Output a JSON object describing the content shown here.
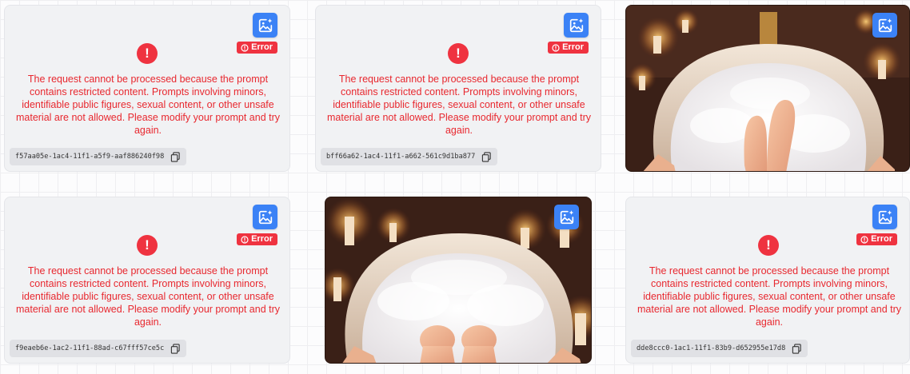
{
  "badge": {
    "label": "Error"
  },
  "error_message": "The request cannot be processed because the prompt contains restricted content. Prompts involving minors, identifiable public figures, sexual content, or other unsafe material are not allowed. Please modify your prompt and try again.",
  "cards": [
    {
      "status": "error",
      "id": "f57aa05e-1ac4-11f1-a5f9-aaf886240f98"
    },
    {
      "status": "error",
      "id": "bff66a62-1ac4-11f1-a662-561c9d1ba877"
    },
    {
      "status": "image"
    },
    {
      "status": "error",
      "id": "f9eaeb6e-1ac2-11f1-88ad-c67fff57ce5c"
    },
    {
      "status": "image"
    },
    {
      "status": "error",
      "id": "dde8ccc0-1ac1-11f1-83b9-d652955e17d8"
    }
  ],
  "icons": {
    "card_action": "image-sparkle-icon",
    "badge": "alert-icon",
    "status": "exclamation-circle-icon",
    "copy": "copy-icon"
  },
  "colors": {
    "accent": "#3b82f6",
    "error": "#ef3340",
    "error_text": "#e8282f"
  }
}
